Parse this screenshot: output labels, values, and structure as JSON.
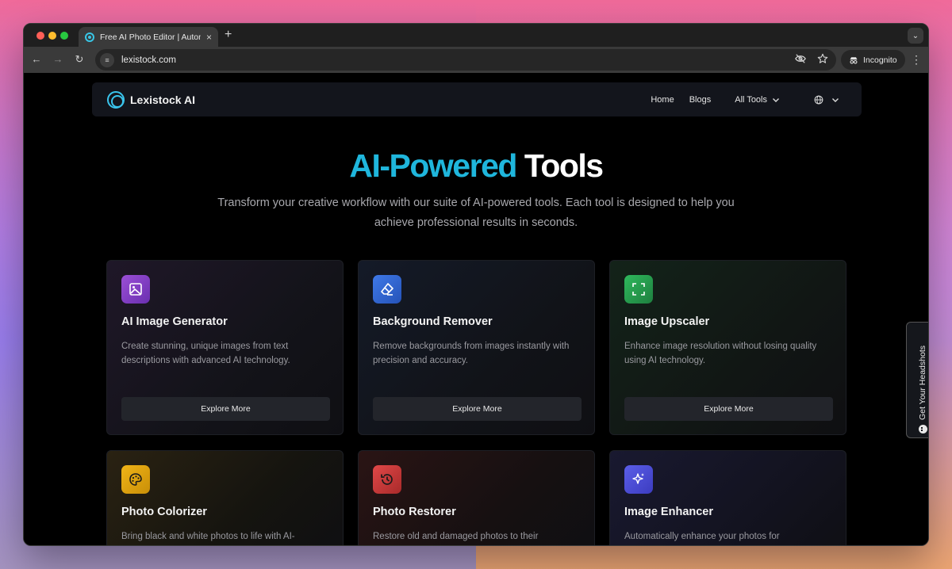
{
  "browser": {
    "tab_title": "Free AI Photo Editor | Automa",
    "tab_close": "×",
    "new_tab": "+",
    "url": "lexistock.com",
    "incognito_label": "Incognito"
  },
  "navbar": {
    "brand": "Lexistock AI",
    "links": {
      "home": "Home",
      "blogs": "Blogs",
      "all_tools": "All Tools"
    }
  },
  "hero": {
    "title_accent": "AI-Powered",
    "title_plain": "Tools",
    "subtitle": "Transform your creative workflow with our suite of AI-powered tools. Each tool is designed to help you achieve professional results in seconds."
  },
  "cards": [
    {
      "title": "AI Image Generator",
      "desc": "Create stunning, unique images from text descriptions with advanced AI technology.",
      "button": "Explore More",
      "icon": "image-icon",
      "icon_color": "#9b4fd6"
    },
    {
      "title": "Background Remover",
      "desc": "Remove backgrounds from images instantly with precision and accuracy.",
      "button": "Explore More",
      "icon": "eraser-icon",
      "icon_color": "#3f79e8"
    },
    {
      "title": "Image Upscaler",
      "desc": "Enhance image resolution without losing quality using AI technology.",
      "button": "Explore More",
      "icon": "expand-icon",
      "icon_color": "#2fb85c"
    },
    {
      "title": "Photo Colorizer",
      "desc": "Bring black and white photos to life with AI-",
      "icon": "palette-icon",
      "icon_color": "#f0b417"
    },
    {
      "title": "Photo Restorer",
      "desc": "Restore old and damaged photos to their",
      "icon": "history-icon",
      "icon_color": "#e04848"
    },
    {
      "title": "Image Enhancer",
      "desc": "Automatically enhance your photos for",
      "icon": "sparkles-icon",
      "icon_color": "#5b5ee8"
    }
  ],
  "side_tab": {
    "label": "Get Your Headshots"
  }
}
